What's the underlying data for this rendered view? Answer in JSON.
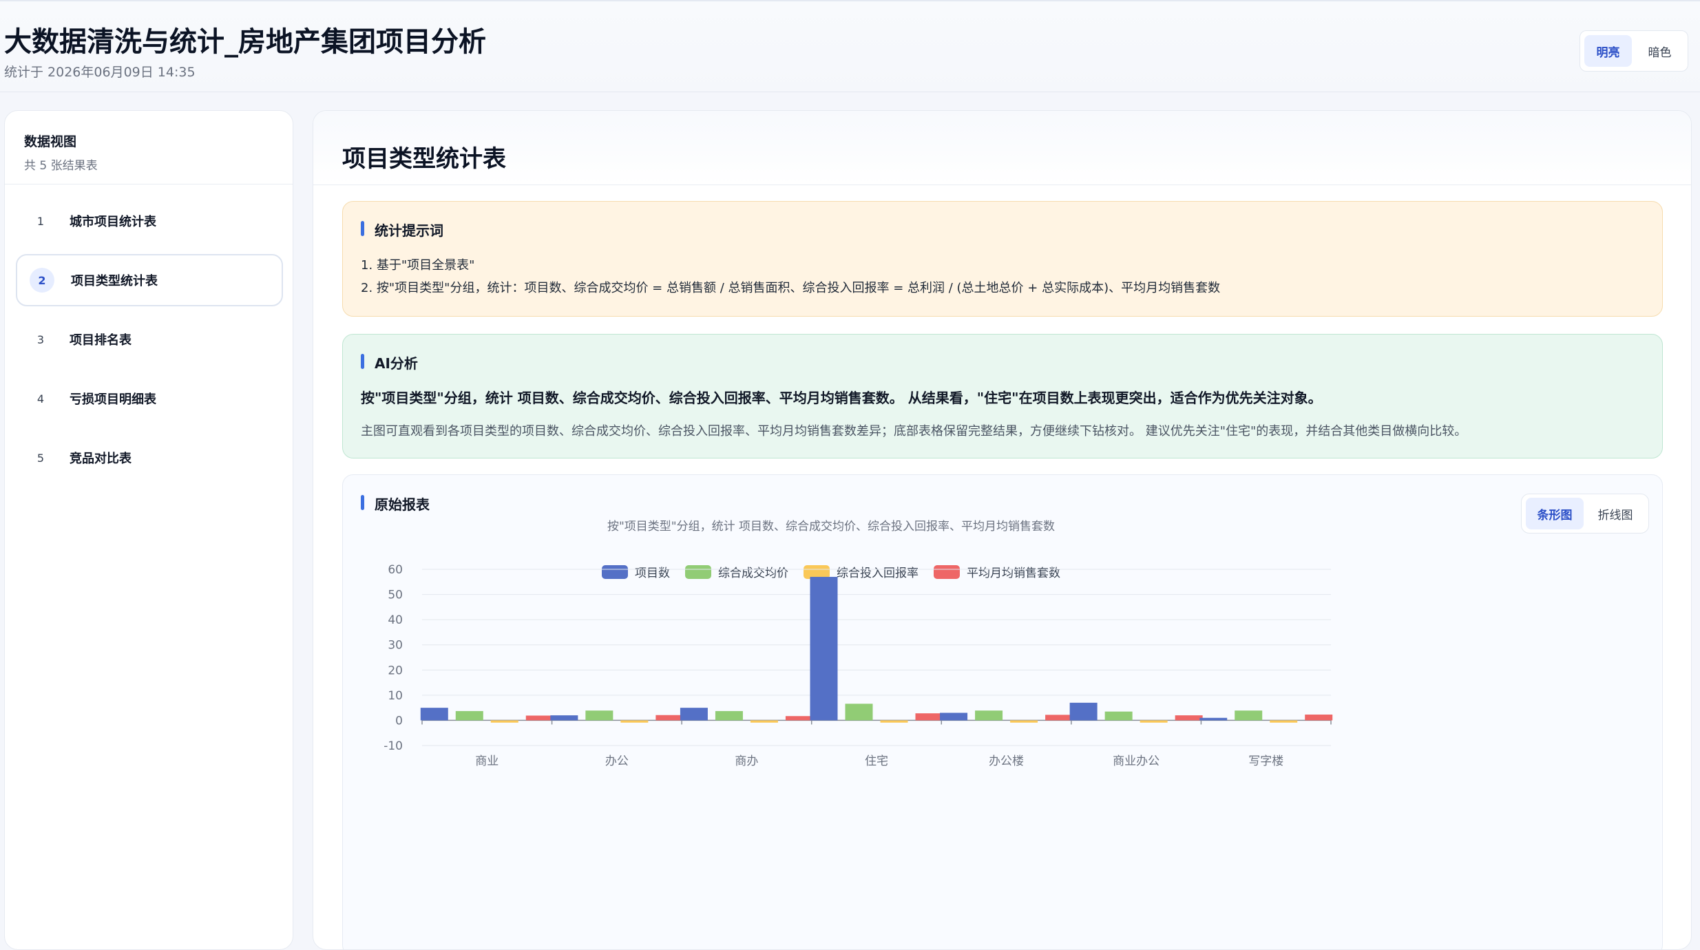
{
  "header": {
    "title": "大数据清洗与统计_房地产集团项目分析",
    "timestamp": "统计于 2026年06月09日 14:35",
    "theme_light": "明亮",
    "theme_dark": "暗色"
  },
  "sidebar": {
    "title": "数据视图",
    "subtitle": "共 5 张结果表",
    "items": [
      {
        "num": "1",
        "label": "城市项目统计表"
      },
      {
        "num": "2",
        "label": "项目类型统计表"
      },
      {
        "num": "3",
        "label": "项目排名表"
      },
      {
        "num": "4",
        "label": "亏损项目明细表"
      },
      {
        "num": "5",
        "label": "竞品对比表"
      }
    ]
  },
  "main": {
    "title": "项目类型统计表",
    "prompt": {
      "title": "统计提示词",
      "line1": "1. 基于\"项目全景表\"",
      "line2": "2. 按\"项目类型\"分组，统计：项目数、综合成交均价 = 总销售额 / 总销售面积、综合投入回报率 = 总利润 / (总土地总价 + 总实际成本)、平均月均销售套数"
    },
    "ai": {
      "title": "AI分析",
      "lead": "按\"项目类型\"分组，统计 项目数、综合成交均价、综合投入回报率、平均月均销售套数。 从结果看，\"住宅\"在项目数上表现更突出，适合作为优先关注对象。",
      "body": "主图可直观看到各项目类型的项目数、综合成交均价、综合投入回报率、平均月均销售套数差异；底部表格保留完整结果，方便继续下钻核对。 建议优先关注\"住宅\"的表现，并结合其他类目做横向比较。"
    },
    "report": {
      "title": "原始报表",
      "subtitle": "按\"项目类型\"分组，统计 项目数、综合成交均价、综合投入回报率、平均月均销售套数",
      "toggle_bar": "条形图",
      "toggle_line": "折线图"
    }
  },
  "colors": {
    "accent": "#3b6fe0",
    "series": [
      "#5470c6",
      "#91cc75",
      "#fac858",
      "#ee6666"
    ]
  },
  "chart_data": {
    "type": "bar",
    "categories": [
      "商业",
      "办公",
      "商办",
      "住宅",
      "办公楼",
      "商业办公",
      "写字楼"
    ],
    "series": [
      {
        "name": "项目数",
        "values": [
          5,
          2,
          5,
          57,
          3,
          7,
          1
        ]
      },
      {
        "name": "综合成交均价",
        "values": [
          3.7,
          3.9,
          3.7,
          6.6,
          3.9,
          3.5,
          3.9
        ]
      },
      {
        "name": "综合投入回报率",
        "values": [
          -0.9,
          -0.9,
          -0.9,
          -0.9,
          -0.9,
          -0.9,
          -0.9
        ]
      },
      {
        "name": "平均月均销售套数",
        "values": [
          1.9,
          2.1,
          1.7,
          2.8,
          2.2,
          2.0,
          2.3
        ]
      }
    ],
    "ylim": [
      -10,
      60
    ],
    "yticks": [
      -10,
      0,
      10,
      20,
      30,
      40,
      50,
      60
    ],
    "grid": true,
    "legend": "top-center"
  }
}
